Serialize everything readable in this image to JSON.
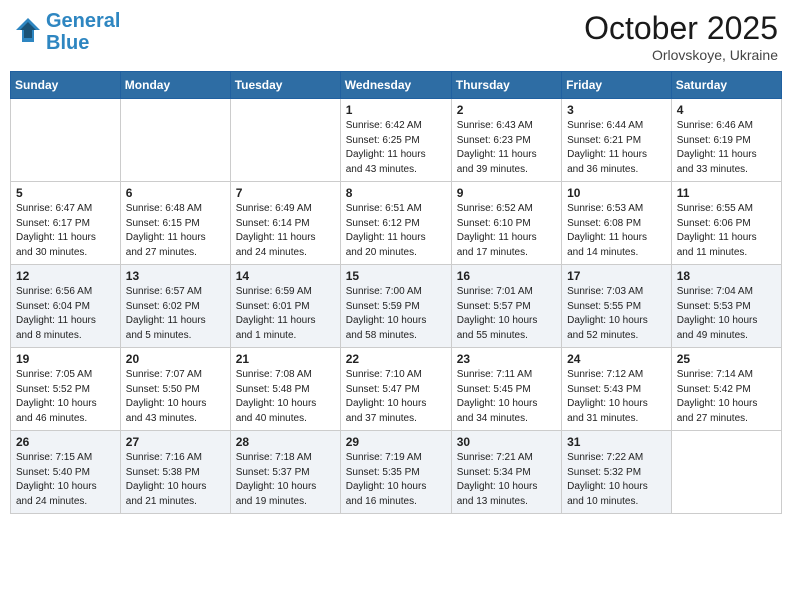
{
  "header": {
    "logo_line1": "General",
    "logo_line2": "Blue",
    "month": "October 2025",
    "location": "Orlovskoye, Ukraine"
  },
  "days_of_week": [
    "Sunday",
    "Monday",
    "Tuesday",
    "Wednesday",
    "Thursday",
    "Friday",
    "Saturday"
  ],
  "weeks": [
    [
      {
        "num": "",
        "info": ""
      },
      {
        "num": "",
        "info": ""
      },
      {
        "num": "",
        "info": ""
      },
      {
        "num": "1",
        "info": "Sunrise: 6:42 AM\nSunset: 6:25 PM\nDaylight: 11 hours\nand 43 minutes."
      },
      {
        "num": "2",
        "info": "Sunrise: 6:43 AM\nSunset: 6:23 PM\nDaylight: 11 hours\nand 39 minutes."
      },
      {
        "num": "3",
        "info": "Sunrise: 6:44 AM\nSunset: 6:21 PM\nDaylight: 11 hours\nand 36 minutes."
      },
      {
        "num": "4",
        "info": "Sunrise: 6:46 AM\nSunset: 6:19 PM\nDaylight: 11 hours\nand 33 minutes."
      }
    ],
    [
      {
        "num": "5",
        "info": "Sunrise: 6:47 AM\nSunset: 6:17 PM\nDaylight: 11 hours\nand 30 minutes."
      },
      {
        "num": "6",
        "info": "Sunrise: 6:48 AM\nSunset: 6:15 PM\nDaylight: 11 hours\nand 27 minutes."
      },
      {
        "num": "7",
        "info": "Sunrise: 6:49 AM\nSunset: 6:14 PM\nDaylight: 11 hours\nand 24 minutes."
      },
      {
        "num": "8",
        "info": "Sunrise: 6:51 AM\nSunset: 6:12 PM\nDaylight: 11 hours\nand 20 minutes."
      },
      {
        "num": "9",
        "info": "Sunrise: 6:52 AM\nSunset: 6:10 PM\nDaylight: 11 hours\nand 17 minutes."
      },
      {
        "num": "10",
        "info": "Sunrise: 6:53 AM\nSunset: 6:08 PM\nDaylight: 11 hours\nand 14 minutes."
      },
      {
        "num": "11",
        "info": "Sunrise: 6:55 AM\nSunset: 6:06 PM\nDaylight: 11 hours\nand 11 minutes."
      }
    ],
    [
      {
        "num": "12",
        "info": "Sunrise: 6:56 AM\nSunset: 6:04 PM\nDaylight: 11 hours\nand 8 minutes."
      },
      {
        "num": "13",
        "info": "Sunrise: 6:57 AM\nSunset: 6:02 PM\nDaylight: 11 hours\nand 5 minutes."
      },
      {
        "num": "14",
        "info": "Sunrise: 6:59 AM\nSunset: 6:01 PM\nDaylight: 11 hours\nand 1 minute."
      },
      {
        "num": "15",
        "info": "Sunrise: 7:00 AM\nSunset: 5:59 PM\nDaylight: 10 hours\nand 58 minutes."
      },
      {
        "num": "16",
        "info": "Sunrise: 7:01 AM\nSunset: 5:57 PM\nDaylight: 10 hours\nand 55 minutes."
      },
      {
        "num": "17",
        "info": "Sunrise: 7:03 AM\nSunset: 5:55 PM\nDaylight: 10 hours\nand 52 minutes."
      },
      {
        "num": "18",
        "info": "Sunrise: 7:04 AM\nSunset: 5:53 PM\nDaylight: 10 hours\nand 49 minutes."
      }
    ],
    [
      {
        "num": "19",
        "info": "Sunrise: 7:05 AM\nSunset: 5:52 PM\nDaylight: 10 hours\nand 46 minutes."
      },
      {
        "num": "20",
        "info": "Sunrise: 7:07 AM\nSunset: 5:50 PM\nDaylight: 10 hours\nand 43 minutes."
      },
      {
        "num": "21",
        "info": "Sunrise: 7:08 AM\nSunset: 5:48 PM\nDaylight: 10 hours\nand 40 minutes."
      },
      {
        "num": "22",
        "info": "Sunrise: 7:10 AM\nSunset: 5:47 PM\nDaylight: 10 hours\nand 37 minutes."
      },
      {
        "num": "23",
        "info": "Sunrise: 7:11 AM\nSunset: 5:45 PM\nDaylight: 10 hours\nand 34 minutes."
      },
      {
        "num": "24",
        "info": "Sunrise: 7:12 AM\nSunset: 5:43 PM\nDaylight: 10 hours\nand 31 minutes."
      },
      {
        "num": "25",
        "info": "Sunrise: 7:14 AM\nSunset: 5:42 PM\nDaylight: 10 hours\nand 27 minutes."
      }
    ],
    [
      {
        "num": "26",
        "info": "Sunrise: 7:15 AM\nSunset: 5:40 PM\nDaylight: 10 hours\nand 24 minutes."
      },
      {
        "num": "27",
        "info": "Sunrise: 7:16 AM\nSunset: 5:38 PM\nDaylight: 10 hours\nand 21 minutes."
      },
      {
        "num": "28",
        "info": "Sunrise: 7:18 AM\nSunset: 5:37 PM\nDaylight: 10 hours\nand 19 minutes."
      },
      {
        "num": "29",
        "info": "Sunrise: 7:19 AM\nSunset: 5:35 PM\nDaylight: 10 hours\nand 16 minutes."
      },
      {
        "num": "30",
        "info": "Sunrise: 7:21 AM\nSunset: 5:34 PM\nDaylight: 10 hours\nand 13 minutes."
      },
      {
        "num": "31",
        "info": "Sunrise: 7:22 AM\nSunset: 5:32 PM\nDaylight: 10 hours\nand 10 minutes."
      },
      {
        "num": "",
        "info": ""
      }
    ]
  ]
}
